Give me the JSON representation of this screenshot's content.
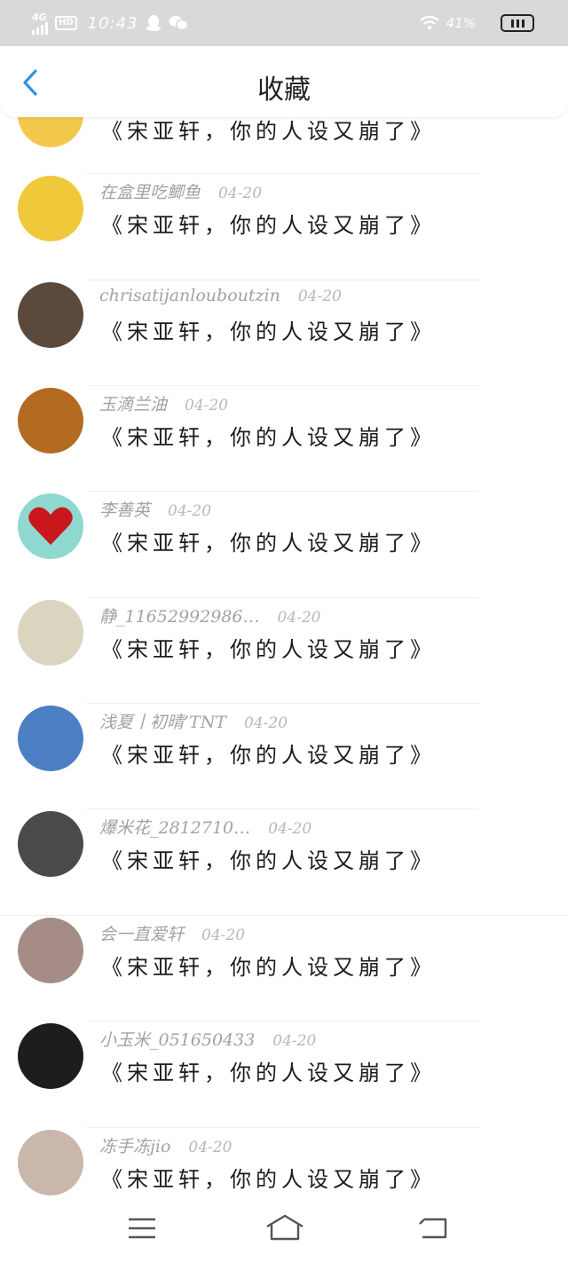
{
  "status_bar": {
    "network": "4G",
    "hd_badge": "HD",
    "time": "10:43",
    "battery_text": "41%",
    "icons": [
      "signal-icon",
      "qq-icon",
      "wechat-icon",
      "wifi-icon",
      "battery-icon"
    ]
  },
  "header": {
    "title": "收藏",
    "back_icon": "chevron-left-icon",
    "accent_color": "#2e95e0"
  },
  "items": [
    {
      "author": "",
      "date": "",
      "content": "《宋亚轩，你的人设又崩了》",
      "avatar_color": "#f2c94c"
    },
    {
      "author": "在盒里吃鲫鱼",
      "date": "04-20",
      "content": "《宋亚轩，你的人设又崩了》",
      "avatar_color": "#f0c93a"
    },
    {
      "author": "chrisatijanlouboutzin",
      "date": "04-20",
      "content": "《宋亚轩，你的人设又崩了》",
      "avatar_color": "#5b4a3c"
    },
    {
      "author": "玉滴兰油",
      "date": "04-20",
      "content": "《宋亚轩，你的人设又崩了》",
      "avatar_color": "#b36a21"
    },
    {
      "author": "李善英",
      "date": "04-20",
      "content": "《宋亚轩，你的人设又崩了》",
      "avatar_color": "#8fd8cf"
    },
    {
      "author": "静_11652992986…",
      "date": "04-20",
      "content": "《宋亚轩，你的人设又崩了》",
      "avatar_color": "#d9d5bf"
    },
    {
      "author": "浅夏丨初晴’TNT",
      "date": "04-20",
      "content": "《宋亚轩，你的人设又崩了》",
      "avatar_color": "#4d7fc4"
    },
    {
      "author": "爆米花_2812710…",
      "date": "04-20",
      "content": "《宋亚轩，你的人设又崩了》",
      "avatar_color": "#4a4a4a"
    },
    {
      "author": "会一直爱轩",
      "date": "04-20",
      "content": "《宋亚轩，你的人设又崩了》",
      "avatar_color": "#a58c86"
    },
    {
      "author": "小玉米_051650433",
      "date": "04-20",
      "content": "《宋亚轩，你的人设又崩了》",
      "avatar_color": "#1d1d1d"
    },
    {
      "author": "冻手冻jio",
      "date": "04-20",
      "content": "《宋亚轩，你的人设又崩了》",
      "avatar_color": "#c9b7ab"
    }
  ],
  "nav_bar": {
    "icons": [
      "menu-icon",
      "home-icon",
      "back-nav-icon"
    ]
  }
}
